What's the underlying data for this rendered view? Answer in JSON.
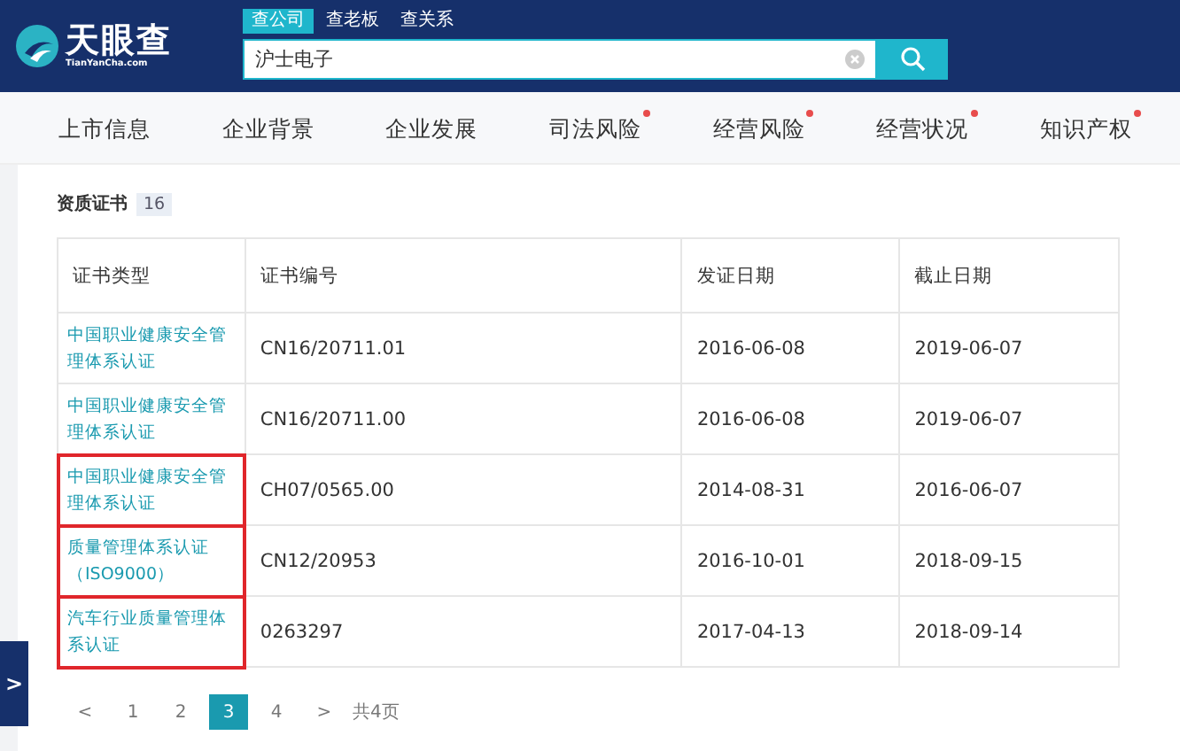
{
  "header": {
    "logo": {
      "name": "天眼查",
      "sub": "TianYanCha.com"
    },
    "search_tabs": [
      {
        "label": "查公司",
        "selected": true
      },
      {
        "label": "查老板",
        "selected": false
      },
      {
        "label": "查关系",
        "selected": false
      }
    ],
    "search": {
      "value": "沪士电子"
    }
  },
  "nav": [
    {
      "label": "上市信息",
      "dot": false
    },
    {
      "label": "企业背景",
      "dot": false
    },
    {
      "label": "企业发展",
      "dot": false
    },
    {
      "label": "司法风险",
      "dot": true
    },
    {
      "label": "经营风险",
      "dot": true
    },
    {
      "label": "经营状况",
      "dot": true
    },
    {
      "label": "知识产权",
      "dot": true
    }
  ],
  "section": {
    "title": "资质证书",
    "count": "16"
  },
  "table": {
    "columns": [
      "证书类型",
      "证书编号",
      "发证日期",
      "截止日期"
    ],
    "rows": [
      {
        "cells": [
          "中国职业健康安全管理体系认证",
          "CN16/20711.01",
          "2016-06-08",
          "2019-06-07"
        ],
        "highlighted": false
      },
      {
        "cells": [
          "中国职业健康安全管理体系认证",
          "CN16/20711.00",
          "2016-06-08",
          "2019-06-07"
        ],
        "highlighted": false
      },
      {
        "cells": [
          "中国职业健康安全管理体系认证",
          "CH07/0565.00",
          "2014-08-31",
          "2016-06-07"
        ],
        "highlighted": true
      },
      {
        "cells": [
          "质量管理体系认证（ISO9000）",
          "CN12/20953",
          "2016-10-01",
          "2018-09-15"
        ],
        "highlighted": true
      },
      {
        "cells": [
          "汽车行业质量管理体系认证",
          "0263297",
          "2017-04-13",
          "2018-09-14"
        ],
        "highlighted": true
      }
    ]
  },
  "pagination": {
    "prev": "<",
    "pages": [
      {
        "label": "1",
        "selected": false
      },
      {
        "label": "2",
        "selected": false
      },
      {
        "label": "3",
        "selected": true
      },
      {
        "label": "4",
        "selected": false
      }
    ],
    "next": ">",
    "total": "共4页"
  },
  "side_tab": {
    "icon": ">"
  }
}
